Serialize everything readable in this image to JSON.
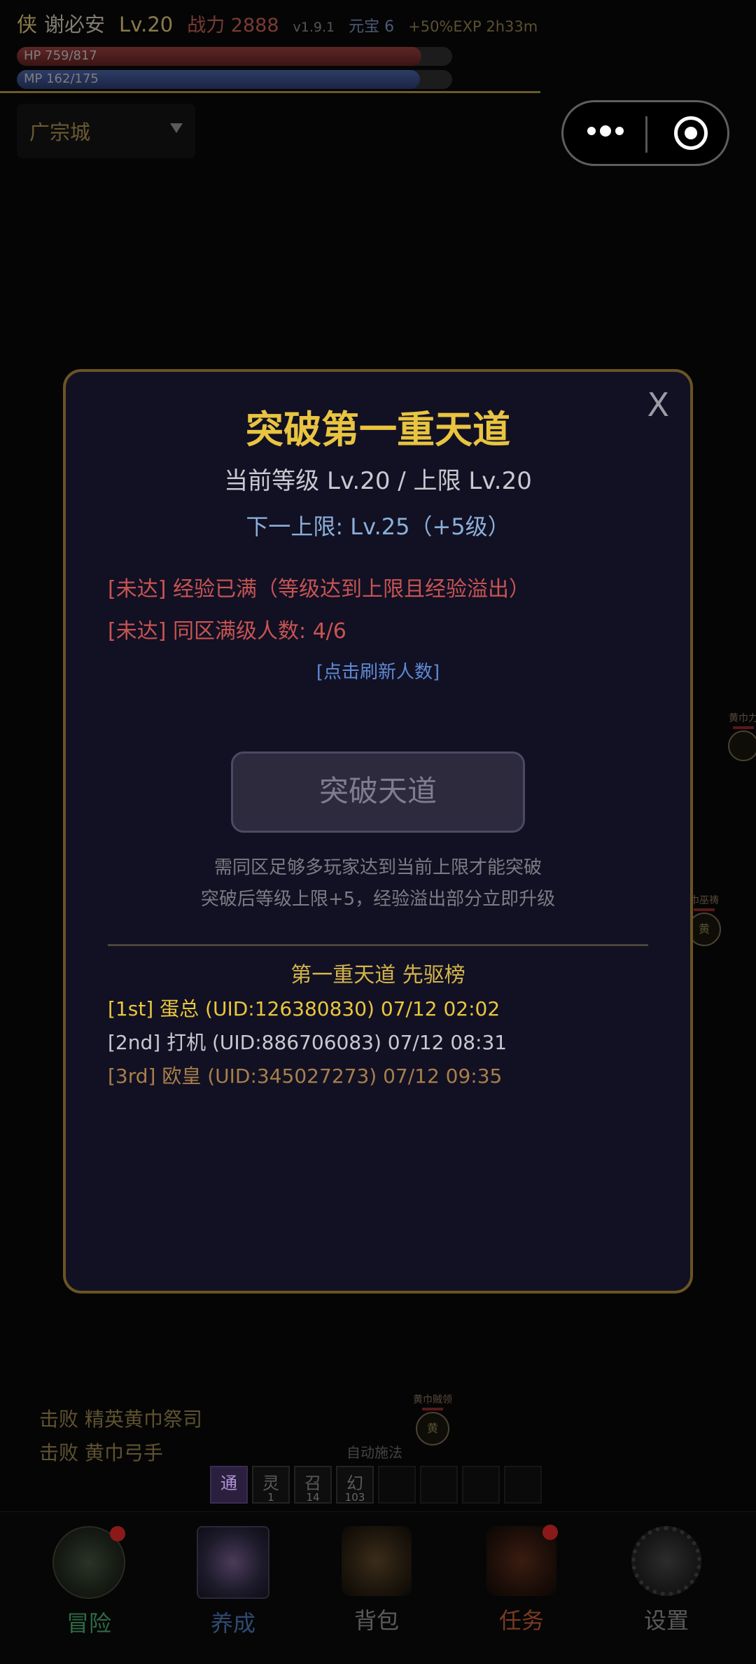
{
  "status": {
    "class_char": "侠",
    "player_name": "谢必安",
    "level": "Lv.20",
    "power": "战力 2888",
    "version": "v1.9.1",
    "gold": "元宝 6",
    "exp_buff": "+50%EXP 2h33m",
    "hp_text": "HP 759/817",
    "hp_fraction": 0.929,
    "mp_text": "MP 162/175",
    "mp_fraction": 0.926
  },
  "location": {
    "label": "广宗城"
  },
  "map_nodes": {
    "n1": "黄巾力",
    "n2": "巾巫祷",
    "n2_icon": "黄",
    "n3": "黄巾贼领",
    "n3_icon": "黄"
  },
  "modal": {
    "title": "突破第一重天道",
    "current": "当前等级 Lv.20 / 上限 Lv.20",
    "next": "下一上限: Lv.25（+5级）",
    "req1": "[未达] 经验已满（等级达到上限且经验溢出）",
    "req2": "[未达] 同区满级人数: 4/6",
    "refresh": "[点击刷新人数]",
    "button": "突破天道",
    "note1": "需同区足够多玩家达到当前上限才能突破",
    "note2": "突破后等级上限+5，经验溢出部分立即升级",
    "leaderboard_title": "第一重天道 先驱榜",
    "leaderboard": [
      "[1st] 蛋总 (UID:126380830) 07/12 02:02",
      "[2nd] 打机 (UID:886706083) 07/12 08:31",
      "[3rd] 欧皇 (UID:345027273) 07/12 09:35"
    ],
    "close": "X"
  },
  "log": [
    "击败 精英黄巾祭司",
    "击败 黄巾弓手"
  ],
  "auto_cast": "自动施法",
  "skills": [
    {
      "glyph": "通",
      "num": ""
    },
    {
      "glyph": "灵",
      "num": "1"
    },
    {
      "glyph": "召",
      "num": "14"
    },
    {
      "glyph": "幻",
      "num": "103"
    }
  ],
  "nav": [
    {
      "label": "冒险",
      "color": "#2f6b45",
      "badge": true
    },
    {
      "label": "养成",
      "color": "#2f4a72",
      "badge": false
    },
    {
      "label": "背包",
      "color": "#5a5a5a",
      "badge": false
    },
    {
      "label": "任务",
      "color": "#7a3a20",
      "badge": true
    },
    {
      "label": "设置",
      "color": "#5a5a5a",
      "badge": false
    }
  ]
}
